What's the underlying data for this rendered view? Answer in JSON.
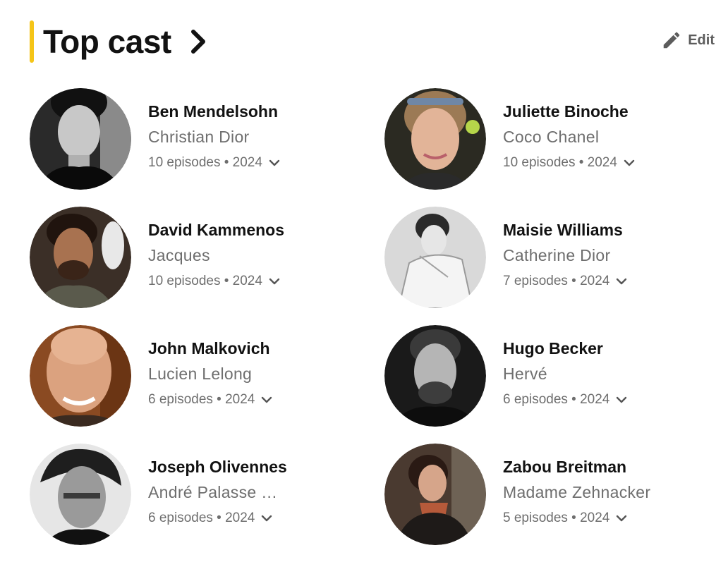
{
  "section": {
    "title": "Top cast",
    "edit_label": "Edit",
    "accent_color": "#f5c518",
    "title_icon": "chevron-right-icon",
    "edit_icon": "pencil-icon"
  },
  "cast": [
    {
      "name": "Ben Mendelsohn",
      "character": "Christian Dior",
      "episodes": "10 episodes • 2024",
      "photo": "black-and-white portrait"
    },
    {
      "name": "Juliette Binoche",
      "character": "Coco Chanel",
      "episodes": "10 episodes • 2024",
      "photo": "color portrait"
    },
    {
      "name": "David Kammenos",
      "character": "Jacques",
      "episodes": "10 episodes • 2024",
      "photo": "color portrait"
    },
    {
      "name": "Maisie Williams",
      "character": "Catherine Dior",
      "episodes": "7 episodes • 2024",
      "photo": "black-and-white portrait"
    },
    {
      "name": "John Malkovich",
      "character": "Lucien Lelong",
      "episodes": "6 episodes • 2024",
      "photo": "color portrait"
    },
    {
      "name": "Hugo Becker",
      "character": "Hervé",
      "episodes": "6 episodes • 2024",
      "photo": "black-and-white portrait"
    },
    {
      "name": "Joseph Olivennes",
      "character": "André Palasse  …",
      "episodes": "6 episodes • 2024",
      "photo": "black-and-white portrait"
    },
    {
      "name": "Zabou Breitman",
      "character": "Madame Zehnacker",
      "episodes": "5 episodes • 2024",
      "photo": "color portrait"
    }
  ]
}
